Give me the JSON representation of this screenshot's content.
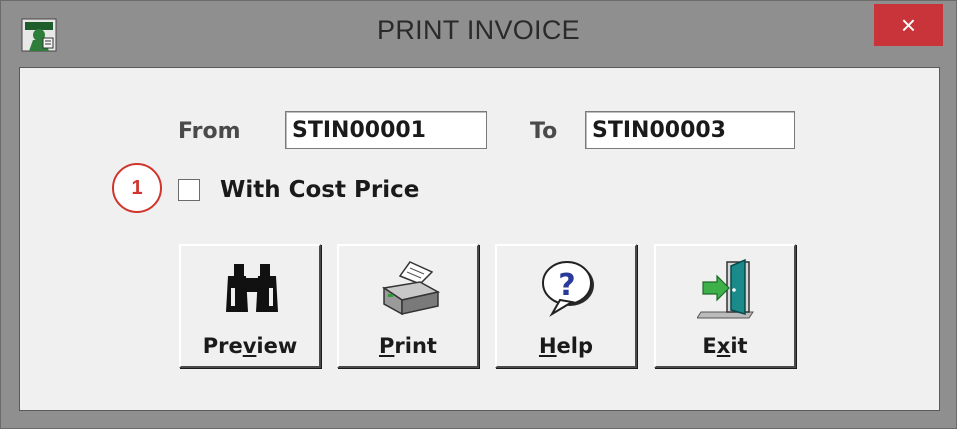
{
  "window": {
    "title": "PRINT INVOICE",
    "close_glyph": "×"
  },
  "range": {
    "from_label": "From",
    "from_value": "STIN00001",
    "to_label": "To",
    "to_value": "STIN00003"
  },
  "option": {
    "badge": "1",
    "with_cost_price_label": "With Cost Price",
    "with_cost_price_checked": false
  },
  "buttons": {
    "preview": {
      "pre": "Pre",
      "key": "v",
      "post": "iew",
      "icon": "binoculars-icon"
    },
    "print": {
      "pre": "",
      "key": "P",
      "post": "rint",
      "icon": "printer-icon"
    },
    "help": {
      "pre": "",
      "key": "H",
      "post": "elp",
      "icon": "help-bubble-icon"
    },
    "exit": {
      "pre": "E",
      "key": "x",
      "post": "it",
      "icon": "exit-door-icon"
    }
  },
  "colors": {
    "titlebar": "#8f8f8f",
    "close_button": "#c8343a",
    "client_bg": "#f0f0f0",
    "annotation": "#d0342c"
  }
}
